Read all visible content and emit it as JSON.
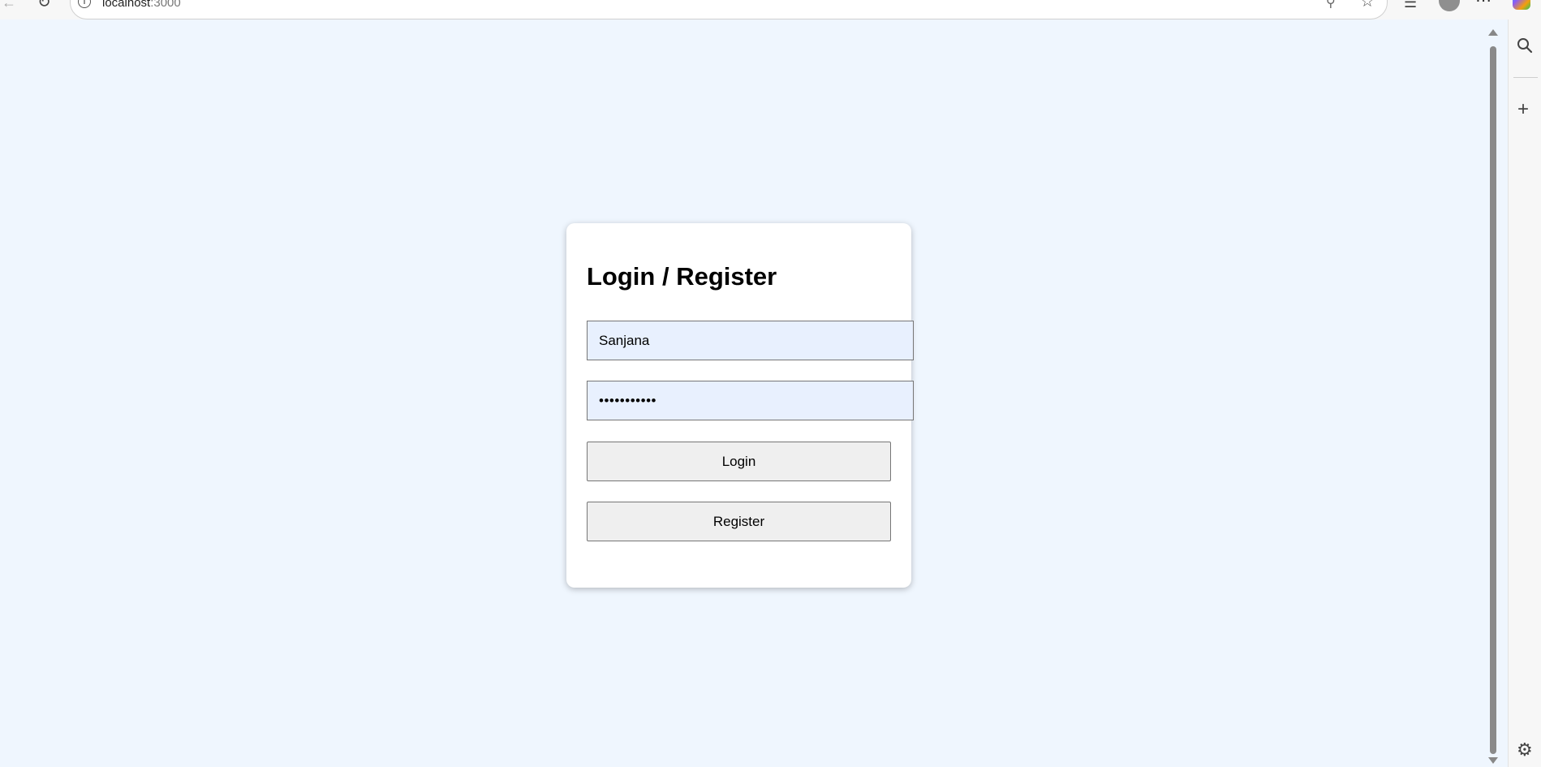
{
  "browser": {
    "url_host": "localhost",
    "url_port": ":3000",
    "icons": {
      "back": "back-arrow-icon",
      "reload": "reload-icon",
      "site_info": "info-icon",
      "key": "key-icon",
      "favorite": "star-icon",
      "favorites_list": "favorites-icon",
      "profile": "profile-icon",
      "more": "more-icon",
      "copilot": "copilot-icon"
    }
  },
  "sidebar": {
    "icons": [
      "search-icon",
      "add-icon",
      "settings-icon"
    ]
  },
  "login_card": {
    "title": "Login / Register",
    "username_value": "Sanjana",
    "password_value": "•••••••••••",
    "login_label": "Login",
    "register_label": "Register"
  },
  "colors": {
    "page_background": "#eff6fe",
    "card_background": "#ffffff",
    "input_background": "#e8f0fe",
    "button_background": "#efefef"
  }
}
